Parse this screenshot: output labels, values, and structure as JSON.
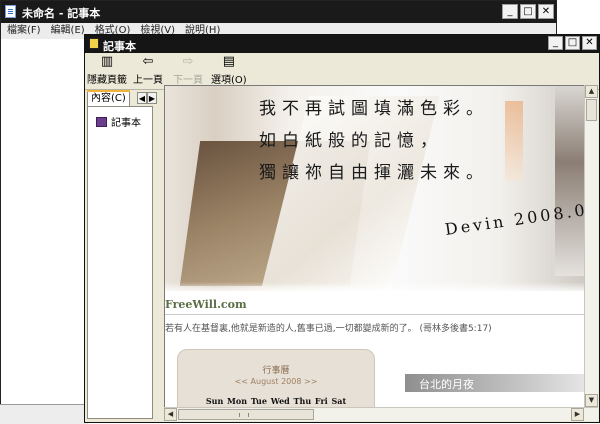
{
  "notepad": {
    "title": "未命名 - 記事本",
    "menu": [
      "檔案(F)",
      "編輯(E)",
      "格式(O)",
      "檢視(V)",
      "說明(H)"
    ],
    "controls": {
      "minimize": "_",
      "maximize": "□",
      "close": "✕"
    }
  },
  "help_window": {
    "title": "記事本",
    "controls": {
      "minimize": "_",
      "maximize": "□",
      "close": "✕"
    },
    "toolbar": {
      "hide_tabs": "隱藏頁籤",
      "back": "上一頁",
      "forward": "下一頁",
      "options": "選項(O)"
    },
    "nav": {
      "tab_label": "內容(C)",
      "arrow_left": "◀",
      "arrow_right": "▶",
      "item_label": "記事本"
    },
    "content": {
      "poem": [
        "我不再試圖填滿色彩。",
        "如白紙般的記憶，",
        "獨讓祢自由揮灑未來。"
      ],
      "signature": "Devin  2008.0",
      "site_title": "FreeWill.com",
      "verse": "若有人在基督裏,他就是新造的人,舊事已過,一切都變成新的了。 (哥林多後書5:17)",
      "calendar": {
        "title": "行事曆",
        "month": "<< August 2008 >>",
        "days": "Sun Mon Tue Wed Thu Fri Sat"
      },
      "side_header": "台北的月夜"
    },
    "scrollbars": {
      "up": "▲",
      "down": "▼",
      "left": "◀",
      "right": "▶"
    }
  }
}
